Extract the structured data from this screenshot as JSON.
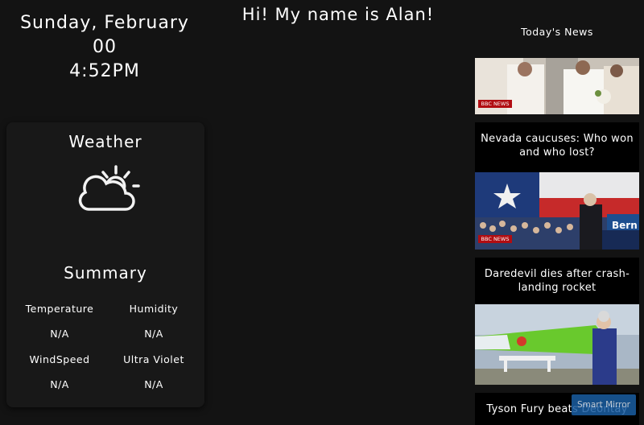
{
  "clock": {
    "date": "Sunday, February",
    "day": "00",
    "time": "4:52PM"
  },
  "greeting": "Hi! My name is Alan!",
  "weather": {
    "title": "Weather",
    "icon": "partly-cloudy-icon",
    "summary_title": "Summary",
    "stats": [
      {
        "label": "Temperature",
        "value": "N/A"
      },
      {
        "label": "Humidity",
        "value": "N/A"
      },
      {
        "label": "WindSpeed",
        "value": "N/A"
      },
      {
        "label": "Ultra Violet",
        "value": "N/A"
      }
    ]
  },
  "news": {
    "header": "Today's News",
    "source_badge": "BBC NEWS",
    "items": [
      {
        "headline": ""
      },
      {
        "headline": "Nevada caucuses: Who won and who lost?",
        "sign_text": "Bern"
      },
      {
        "headline": "Daredevil dies after crash-landing rocket"
      },
      {
        "headline": "Tyson Fury beats Deontay"
      }
    ]
  },
  "overlay_button": "Smart Mirror"
}
